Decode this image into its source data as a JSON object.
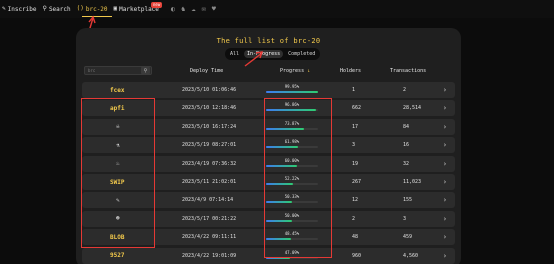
{
  "nav": {
    "items": [
      {
        "icon": "✎",
        "label": "Inscribe"
      },
      {
        "icon": "⚲",
        "label": "Search"
      },
      {
        "icon": "()",
        "label": "brc-20"
      },
      {
        "icon": "▣",
        "label": "Marketplace"
      }
    ],
    "badge": "new",
    "social": [
      "◐",
      "♞",
      "☁",
      "✉",
      "♥"
    ]
  },
  "panel": {
    "title": "The full list of brc-20",
    "tabs": [
      "All",
      "In-Progress",
      "Completed"
    ],
    "active_tab": "In-Progress",
    "search_placeholder": "brc",
    "search_icon": "⚲",
    "columns": {
      "deploy_time": "Deploy Time",
      "progress": "Progress",
      "progress_sort": "↓",
      "holders": "Holders",
      "transactions": "Transactions"
    }
  },
  "rows": [
    {
      "tick": "fcex",
      "deploy_time": "2023/5/10 01:06:46",
      "progress_label": "99.95%",
      "progress": 0.9995,
      "holders": "1",
      "transactions": "2"
    },
    {
      "tick": "apfi",
      "deploy_time": "2023/5/10 12:18:46",
      "progress_label": "96.86%",
      "progress": 0.9686,
      "holders": "662",
      "transactions": "28,514"
    },
    {
      "tick": "☠",
      "deploy_time": "2023/5/10 16:17:24",
      "progress_label": "73.87%",
      "progress": 0.7387,
      "holders": "17",
      "transactions": "84"
    },
    {
      "tick": "⚗",
      "deploy_time": "2023/5/19 08:27:01",
      "progress_label": "61.98%",
      "progress": 0.6198,
      "holders": "3",
      "transactions": "16"
    },
    {
      "tick": "♨",
      "deploy_time": "2023/4/19 07:36:32",
      "progress_label": "60.00%",
      "progress": 0.6,
      "holders": "19",
      "transactions": "32"
    },
    {
      "tick": "SWIP",
      "deploy_time": "2023/5/11 21:02:01",
      "progress_label": "52.22%",
      "progress": 0.5222,
      "holders": "267",
      "transactions": "11,023"
    },
    {
      "tick": "✎",
      "deploy_time": "2023/4/9 07:14:14",
      "progress_label": "50.33%",
      "progress": 0.5033,
      "holders": "12",
      "transactions": "155"
    },
    {
      "tick": "☻",
      "deploy_time": "2023/5/17 00:21:22",
      "progress_label": "50.00%",
      "progress": 0.5,
      "holders": "2",
      "transactions": "3"
    },
    {
      "tick": "BLOB",
      "deploy_time": "2023/4/22 09:11:11",
      "progress_label": "48.45%",
      "progress": 0.4845,
      "holders": "48",
      "transactions": "459"
    },
    {
      "tick": "9527",
      "deploy_time": "2023/4/22 19:01:09",
      "progress_label": "47.09%",
      "progress": 0.4709,
      "holders": "960",
      "transactions": "4,560"
    }
  ],
  "colors": {
    "accent": "#f2c94c",
    "annotation": "#e53935",
    "row_bg": "#2c2c2c"
  }
}
